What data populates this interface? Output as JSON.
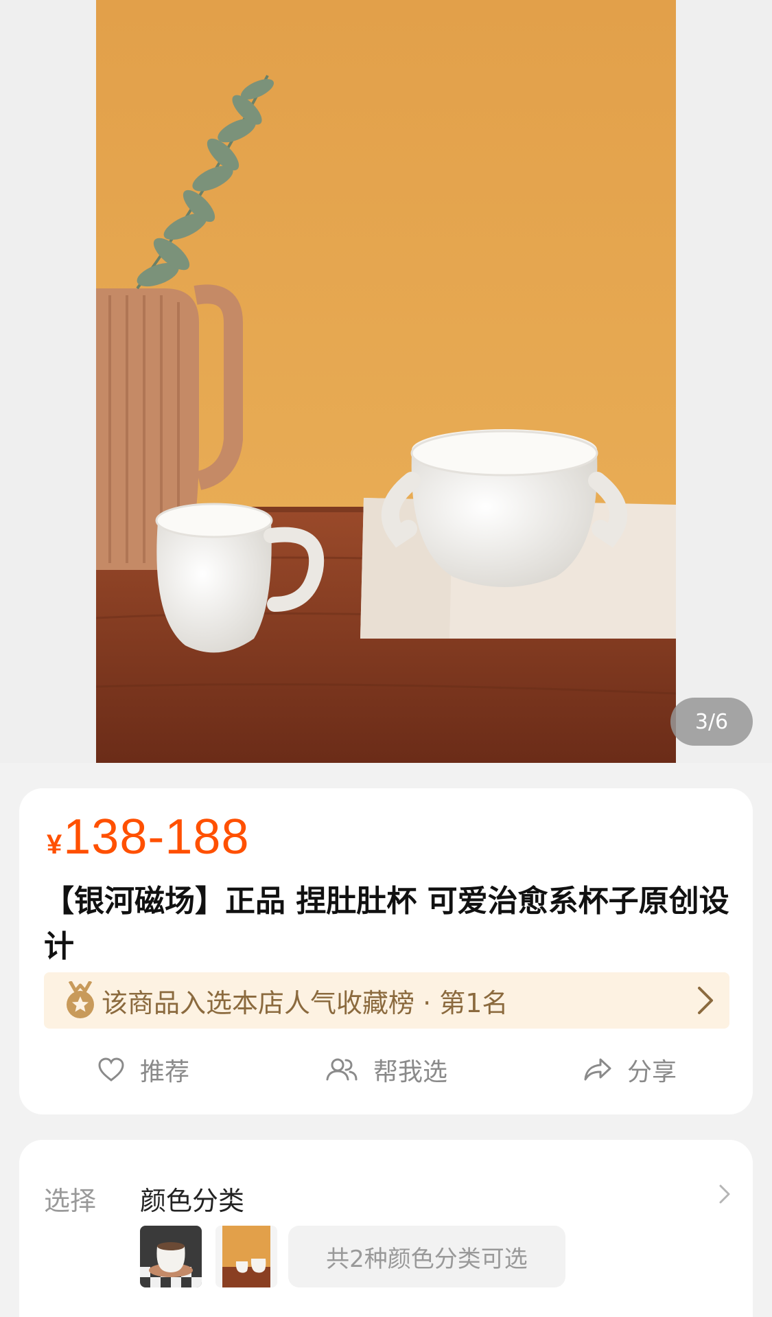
{
  "gallery": {
    "image_alt": "产品图",
    "indicator": "3/6"
  },
  "product": {
    "currency": "¥",
    "price": "138-188",
    "price_color": "#ff5000",
    "title": "【银河磁场】正品 捏肚肚杯 可爱治愈系杯子原创设计",
    "rank_text": "该商品入选本店人气收藏榜 · 第1名"
  },
  "actions": {
    "like_label": "推荐",
    "help_label": "帮我选",
    "share_label": "分享"
  },
  "sku": {
    "label": "选择",
    "name": "颜色分类",
    "count_text": "共2种颜色分类可选"
  },
  "icons": [
    "medal-icon",
    "chevron-right-icon",
    "heart-icon",
    "people-icon",
    "share-icon"
  ]
}
